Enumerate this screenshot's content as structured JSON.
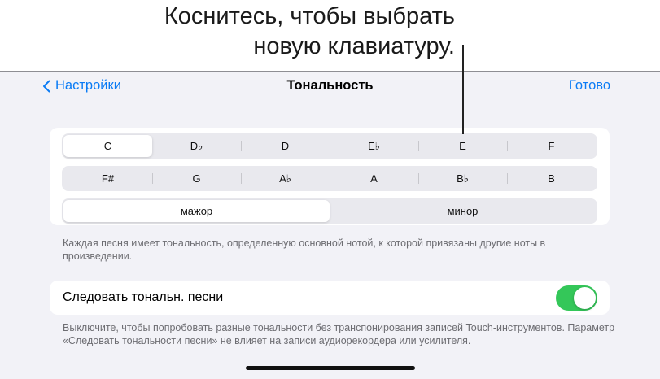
{
  "callout": {
    "line1": "Коснитесь, чтобы выбрать",
    "line2": "новую клавиатуру."
  },
  "nav": {
    "back_label": "Настройки",
    "title": "Тональность",
    "done_label": "Готово"
  },
  "keys": {
    "row1": [
      "C",
      "D♭",
      "D",
      "E♭",
      "E",
      "F"
    ],
    "row2": [
      "F#",
      "G",
      "A♭",
      "A",
      "B♭",
      "B"
    ],
    "selected": "C"
  },
  "mode": {
    "options": [
      "мажор",
      "минор"
    ],
    "selected": "мажор"
  },
  "key_footnote": "Каждая песня имеет тональность, определенную основной нотой, к которой привязаны другие ноты в произведении.",
  "follow_key": {
    "label": "Следовать тональн. песни",
    "enabled": true,
    "color": "#34c759"
  },
  "follow_footnote": "Выключите, чтобы попробовать разные тональности без транспонирования записей Touch-инструментов. Параметр «Следовать тональности песни» не влияет на записи аудиорекордера или усилителя.",
  "colors": {
    "accent": "#0a7bf5",
    "background": "#f2f2f7"
  }
}
